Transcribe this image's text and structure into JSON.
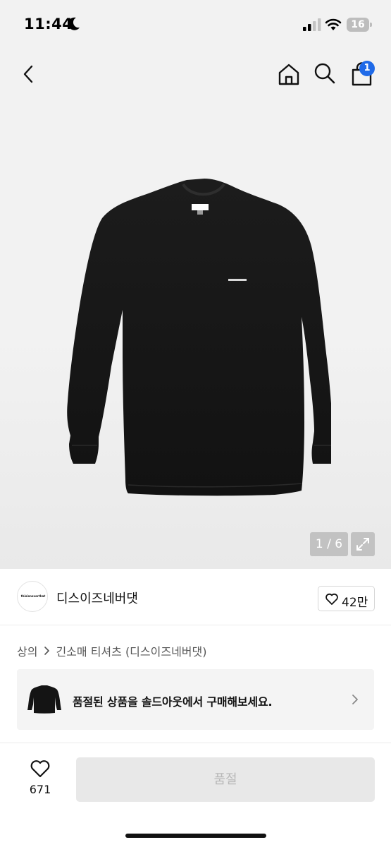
{
  "status_bar": {
    "time": "11:44",
    "battery": "16",
    "icons": [
      "moon-icon",
      "signal-icon",
      "wifi-icon",
      "battery-icon"
    ]
  },
  "header": {
    "icons": [
      "back-icon",
      "home-icon",
      "search-icon",
      "cart-icon"
    ],
    "cart_badge": "1"
  },
  "gallery": {
    "counter": "1 / 6",
    "expand_icon": "expand-icon"
  },
  "brand": {
    "logo_text": "thisisneverthat",
    "name": "디스이즈네버댓",
    "likes": "42만"
  },
  "breadcrumb": {
    "category": "상의",
    "product": "긴소매 티셔츠 (디스이즈네버댓)"
  },
  "banner": {
    "text": "품절된 상품을 솔드아웃에서 구매해보세요."
  },
  "bottom_bar": {
    "wish_count": "671",
    "buy_label": "품절"
  },
  "colors": {
    "accent": "#1f6ae8",
    "disabled_button_bg": "#e8e8e8",
    "disabled_button_text": "#b8b8b8"
  }
}
